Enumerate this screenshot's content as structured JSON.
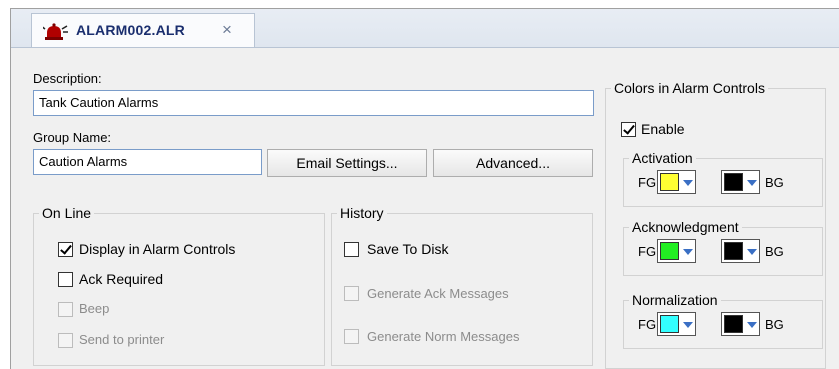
{
  "tab": {
    "title": "ALARM002.ALR",
    "close": "×"
  },
  "form": {
    "description_label": "Description:",
    "description_value": "Tank Caution Alarms",
    "group_label": "Group Name:",
    "group_value": "Caution Alarms",
    "email_button": "Email Settings...",
    "advanced_button": "Advanced..."
  },
  "online": {
    "legend": "On Line",
    "items": [
      {
        "label": "Display in Alarm Controls",
        "checked": true,
        "enabled": true
      },
      {
        "label": "Ack Required",
        "checked": false,
        "enabled": true
      },
      {
        "label": "Beep",
        "checked": false,
        "enabled": false
      },
      {
        "label": "Send to printer",
        "checked": false,
        "enabled": false
      }
    ]
  },
  "history": {
    "legend": "History",
    "items": [
      {
        "label": "Save To Disk",
        "checked": false,
        "enabled": true
      },
      {
        "label": "Generate Ack Messages",
        "checked": false,
        "enabled": false
      },
      {
        "label": "Generate Norm Messages",
        "checked": false,
        "enabled": false
      }
    ]
  },
  "colors": {
    "legend": "Colors in Alarm Controls",
    "enable_label": "Enable",
    "enable_checked": true,
    "fg_label": "FG",
    "bg_label": "BG",
    "groups": [
      {
        "legend": "Activation",
        "fg": "#ffff33",
        "bg": "#000000"
      },
      {
        "legend": "Acknowledgment",
        "fg": "#22ee22",
        "bg": "#000000"
      },
      {
        "legend": "Normalization",
        "fg": "#33ffff",
        "bg": "#000000"
      }
    ]
  }
}
